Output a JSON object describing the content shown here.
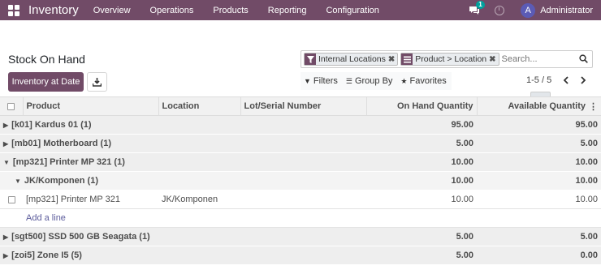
{
  "navbar": {
    "app_name": "Inventory",
    "menu": [
      "Overview",
      "Operations",
      "Products",
      "Reporting",
      "Configuration"
    ],
    "chat_badge": "1",
    "user_initial": "A",
    "user_name": "Administrator"
  },
  "page": {
    "title": "Stock On Hand",
    "primary_button": "Inventory at Date"
  },
  "search": {
    "facets": [
      {
        "icon": "filter-icon",
        "label": "Internal Locations"
      },
      {
        "icon": "group-by-icon",
        "label": "Product > Location"
      }
    ],
    "placeholder": "Search..."
  },
  "filters": {
    "filters_label": "Filters",
    "groupby_label": "Group By",
    "favorites_label": "Favorites"
  },
  "pager": {
    "value": "1-5 / 5"
  },
  "views": [
    "list-view-icon",
    "pivot-view-icon",
    "graph-view-icon"
  ],
  "table": {
    "columns": [
      "Product",
      "Location",
      "Lot/Serial Number",
      "On Hand Quantity",
      "Available Quantity"
    ],
    "rows": [
      {
        "kind": "group",
        "label": "[k01] Kardus 01 (1)",
        "on_hand": "95.00",
        "available": "95.00"
      },
      {
        "kind": "group",
        "label": "[mb01] Motherboard (1)",
        "on_hand": "5.00",
        "available": "5.00"
      },
      {
        "kind": "group-open",
        "label": "[mp321] Printer MP 321 (1)",
        "on_hand": "10.00",
        "available": "10.00"
      },
      {
        "kind": "subgroup",
        "label": "JK/Komponen (1)",
        "on_hand": "10.00",
        "available": "10.00"
      },
      {
        "kind": "record",
        "product": "[mp321] Printer MP 321",
        "location": "JK/Komponen",
        "lot": "",
        "on_hand": "10.00",
        "available": "10.00"
      },
      {
        "kind": "add",
        "label": "Add a line"
      },
      {
        "kind": "group",
        "label": "[sgt500] SSD 500 GB Seagata (1)",
        "on_hand": "5.00",
        "available": "5.00"
      },
      {
        "kind": "group",
        "label": "[zoi5] Zone I5 (5)",
        "on_hand": "5.00",
        "available": "0.00"
      }
    ]
  }
}
